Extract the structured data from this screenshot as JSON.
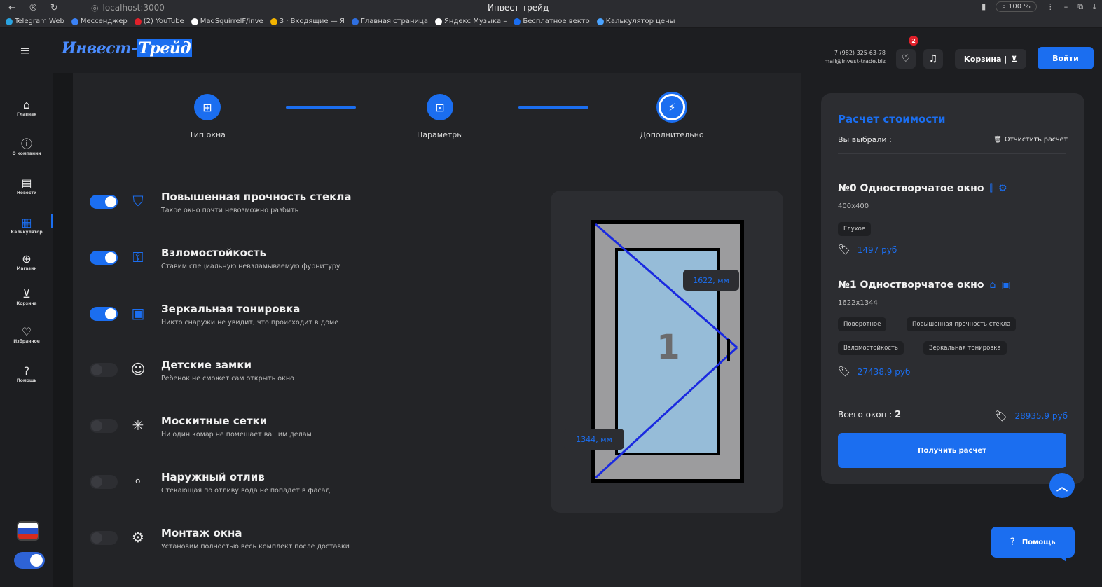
{
  "browser": {
    "url": "localhost:3000",
    "tab_title": "Инвест-трейд",
    "zoom": "100 %",
    "bookmarks": [
      {
        "label": "Telegram Web",
        "color": "#2aa3e0"
      },
      {
        "label": "Мессенджер",
        "color": "#3b82f6"
      },
      {
        "label": "(2) YouTube",
        "color": "#e0202a"
      },
      {
        "label": "MadSquirrelF/inve",
        "color": "#ffffff"
      },
      {
        "label": "3 · Входящие — Я",
        "color": "#f2b300"
      },
      {
        "label": "Главная страница",
        "color": "#2f6fe0"
      },
      {
        "label": "Яндекс Музыка –",
        "color": "#ffffff"
      },
      {
        "label": "Бесплатное векто",
        "color": "#1b6ef0"
      },
      {
        "label": "Калькулятор цены",
        "color": "#4aa3ff"
      }
    ]
  },
  "header": {
    "logo_main": "Инвест-",
    "logo_accent": "Трейд",
    "phone": "+7 (982) 325-63-78",
    "email": "mail@invest-trade.biz",
    "favorites_count": "2",
    "cart_label": "Корзина |",
    "login_label": "Войти"
  },
  "leftnav": [
    {
      "label": "Главная",
      "icon": "home-icon",
      "glyph": "⌂"
    },
    {
      "label": "О компании",
      "icon": "info-icon",
      "glyph": "ⓘ"
    },
    {
      "label": "Новости",
      "icon": "news-icon",
      "glyph": "▤"
    },
    {
      "label": "Калькулятор",
      "icon": "calculator-icon",
      "glyph": "▦"
    },
    {
      "label": "Магазин",
      "icon": "shop-icon",
      "glyph": "⊕"
    },
    {
      "label": "Корзина",
      "icon": "cart-icon",
      "glyph": "⊻"
    },
    {
      "label": "Избранное",
      "icon": "heart-icon",
      "glyph": "♡"
    },
    {
      "label": "Помощь",
      "icon": "help-icon",
      "glyph": "?"
    }
  ],
  "steps": [
    {
      "label": "Тип окна",
      "icon": "window-grid-icon",
      "glyph": "⊞"
    },
    {
      "label": "Параметры",
      "icon": "parameters-icon",
      "glyph": "⊡"
    },
    {
      "label": "Дополнительно",
      "icon": "extras-icon",
      "glyph": "⚡"
    }
  ],
  "options": [
    {
      "title": "Повышенная прочность стекла",
      "desc": "Такое окно почти невозможно разбить",
      "enabled": true,
      "icon": "shield-icon",
      "glyph": "⛉"
    },
    {
      "title": "Взломостойкость",
      "desc": "Ставим специальную невзламываемую фурнитуру",
      "enabled": true,
      "icon": "burglar-icon",
      "glyph": "⚿"
    },
    {
      "title": "Зеркальная тонировка",
      "desc": "Никто снаружи не увидит, что происходит в доме",
      "enabled": true,
      "icon": "mirror-icon",
      "glyph": "▣"
    },
    {
      "title": "Детские замки",
      "desc": "Ребенок не сможет сам открыть окно",
      "enabled": false,
      "icon": "child-icon",
      "glyph": "☺"
    },
    {
      "title": "Москитные сетки",
      "desc": "Ни один комар не помешает вашим делам",
      "enabled": false,
      "icon": "mosquito-net-icon",
      "glyph": "✳"
    },
    {
      "title": "Наружный отлив",
      "desc": "Стекающая по отливу вода не попадет в фасад",
      "enabled": false,
      "icon": "drops-icon",
      "glyph": "৹"
    },
    {
      "title": "Монтаж окна",
      "desc": "Установим полностью весь комплект после доставки",
      "enabled": false,
      "icon": "wrench-icon",
      "glyph": "⚙"
    }
  ],
  "preview": {
    "sash_number": "1",
    "height_label": "1622, мм",
    "width_label": "1344, мм"
  },
  "calc": {
    "title": "Расчет стоимости",
    "chosen_label": "Вы выбрали :",
    "clear_label": "Отчистить расчет",
    "items": [
      {
        "title": "№0 Одностворчатое окно",
        "size": "400x400",
        "chips": [
          "Глухое"
        ],
        "price": "1497 руб"
      },
      {
        "title": "№1 Одностворчатое окно",
        "size": "1622x1344",
        "chips": [
          "Поворотное",
          "Повышенная прочность стекла",
          "Взломостойкость",
          "Зеркальная тонировка"
        ],
        "price": "27438.9 руб"
      }
    ],
    "total_label": "Всего окон :",
    "total_count": "2",
    "total_price": "28935.9 руб",
    "submit_label": "Получить расчет"
  },
  "help_label": "Помощь",
  "colors": {
    "accent": "#1b6ef0",
    "bg": "#1f2023",
    "card": "#2c2d31"
  }
}
